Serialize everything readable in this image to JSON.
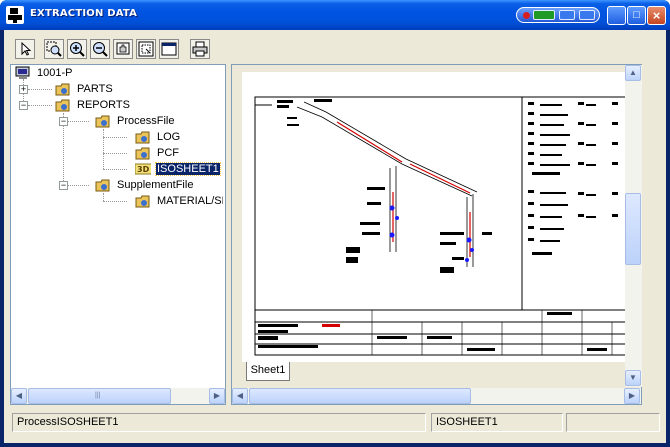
{
  "window": {
    "title": "EXTRACTION DATA"
  },
  "toolbar": {
    "buttons": [
      {
        "name": "select-pointer-button",
        "icon": "arrow-pointer-icon"
      },
      {
        "name": "zoom-window-button",
        "icon": "zoom-window-icon"
      },
      {
        "name": "zoom-in-button",
        "icon": "zoom-in-icon"
      },
      {
        "name": "zoom-out-button",
        "icon": "zoom-out-icon"
      },
      {
        "name": "pan-button",
        "icon": "pan-icon"
      },
      {
        "name": "fit-all-button",
        "icon": "fit-all-icon"
      },
      {
        "name": "window-view-button",
        "icon": "window-icon"
      },
      {
        "name": "print-button",
        "icon": "printer-icon"
      }
    ]
  },
  "tree": {
    "root": "1001-P",
    "parts": "PARTS",
    "reports": "REPORTS",
    "process_file": "ProcessFile",
    "log": "LOG",
    "pcf": "PCF",
    "isosheet": "ISOSHEET1",
    "supplement_file": "SupplementFile",
    "material": "MATERIAL/SH"
  },
  "drawing": {
    "sheet_tab": "Sheet1"
  },
  "statusbar": {
    "path": "ProcessISOSHEET1",
    "item": "ISOSHEET1",
    "extra": ""
  },
  "colors": {
    "title_bar": "#0054e3",
    "selection": "#0a246a",
    "pipe_red": "#d40000",
    "weld_blue": "#1a1aff"
  }
}
